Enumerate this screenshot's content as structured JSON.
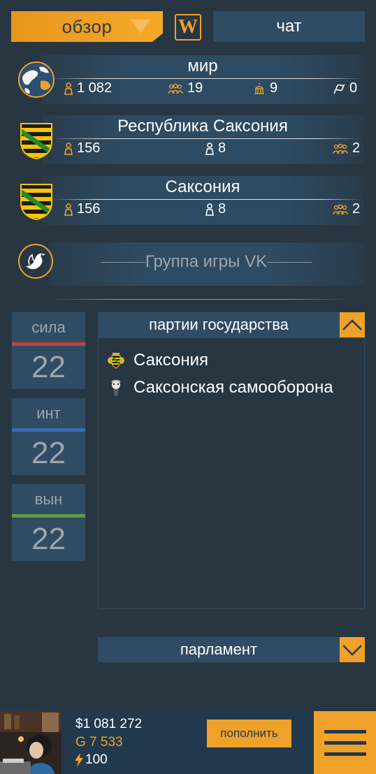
{
  "top_tabs": {
    "overview": "обзор",
    "wiki": "W",
    "chat": "чат"
  },
  "regions": [
    {
      "title": "мир",
      "stats": [
        {
          "icon": "person-icon",
          "value": "1 082"
        },
        {
          "icon": "people-group-icon",
          "value": "19"
        },
        {
          "icon": "capitol-icon",
          "value": "9"
        },
        {
          "icon": "flag-icon",
          "value": "0"
        }
      ]
    },
    {
      "title": "Республика Саксония",
      "stats": [
        {
          "icon": "person-icon",
          "value": "156"
        },
        {
          "icon": "person-outline-icon",
          "value": "8"
        },
        {
          "icon": "people-group-icon",
          "value": "2"
        }
      ]
    },
    {
      "title": "Саксония",
      "stats": [
        {
          "icon": "person-icon",
          "value": "156"
        },
        {
          "icon": "person-outline-icon",
          "value": "8"
        },
        {
          "icon": "people-group-icon",
          "value": "2"
        }
      ]
    }
  ],
  "vk_group": "Группа игры VK",
  "attributes": [
    {
      "label": "сила",
      "value": "22",
      "color": "#c0433d"
    },
    {
      "label": "инт",
      "value": "22",
      "color": "#3a6ab4"
    },
    {
      "label": "вын",
      "value": "22",
      "color": "#5e9d43"
    }
  ],
  "parties_panel": {
    "title": "партии государства",
    "items": [
      {
        "name": "Саксония",
        "icon": "coat-of-arms-icon"
      },
      {
        "name": "Саксонская самооборона",
        "icon": "party-avatar-icon"
      }
    ]
  },
  "parliament": {
    "title": "парламент"
  },
  "bottom": {
    "money": "$1 081 272",
    "gold": "G 7 533",
    "energy": "100",
    "topup": "пополнить"
  },
  "colors": {
    "accent": "#f0a12a",
    "panel": "#2f4c64",
    "background": "#283642"
  }
}
